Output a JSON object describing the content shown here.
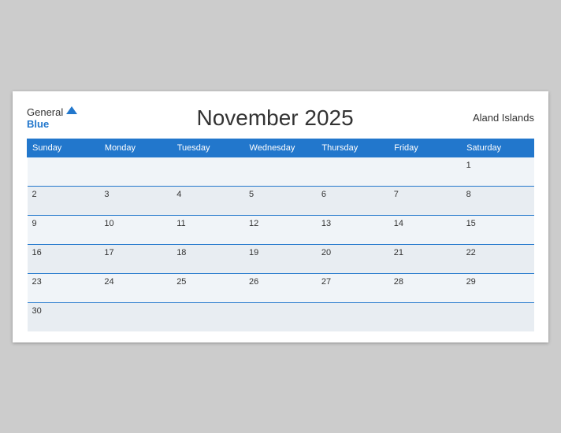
{
  "header": {
    "logo_general": "General",
    "logo_blue": "Blue",
    "title": "November 2025",
    "region": "Aland Islands"
  },
  "weekdays": [
    "Sunday",
    "Monday",
    "Tuesday",
    "Wednesday",
    "Thursday",
    "Friday",
    "Saturday"
  ],
  "weeks": [
    [
      null,
      null,
      null,
      null,
      null,
      null,
      1
    ],
    [
      2,
      3,
      4,
      5,
      6,
      7,
      8
    ],
    [
      9,
      10,
      11,
      12,
      13,
      14,
      15
    ],
    [
      16,
      17,
      18,
      19,
      20,
      21,
      22
    ],
    [
      23,
      24,
      25,
      26,
      27,
      28,
      29
    ],
    [
      30,
      null,
      null,
      null,
      null,
      null,
      null
    ]
  ]
}
